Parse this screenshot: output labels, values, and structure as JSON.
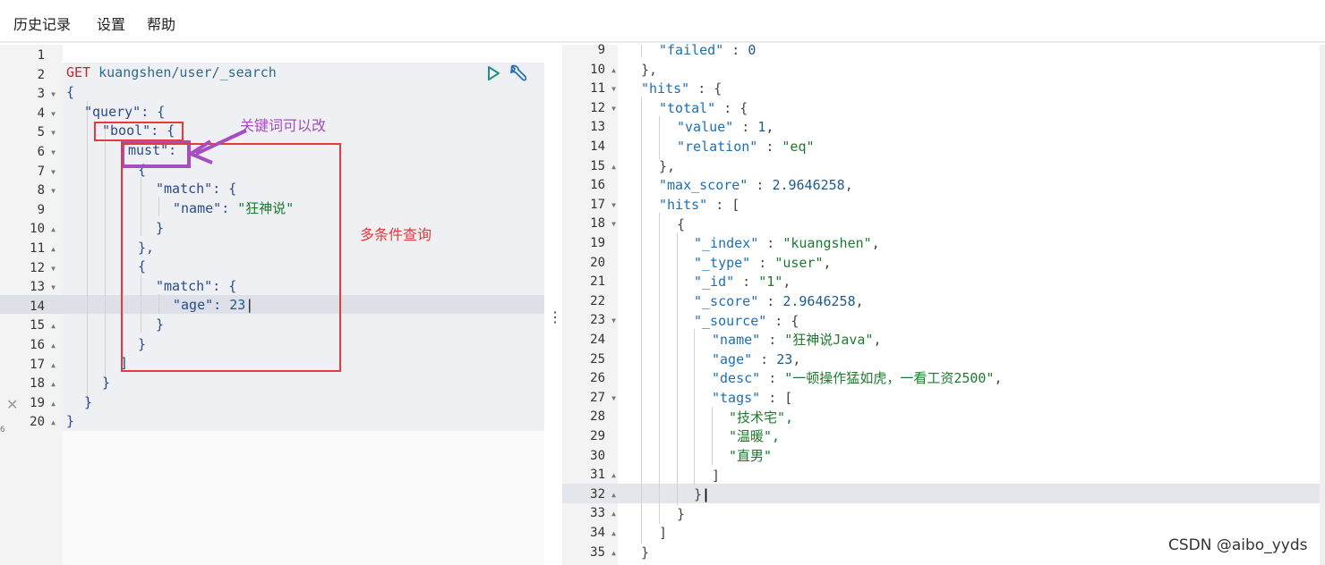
{
  "menu": {
    "history": "历史记录",
    "settings": "设置",
    "help": "帮助"
  },
  "request": {
    "method": "GET",
    "url": "kuangshen/user/_search"
  },
  "annotations": {
    "keyword_changeable": "关键词可以改",
    "multi_condition": "多条件查询"
  },
  "watermark": "CSDN @aibo_yyds",
  "splitter": "⋮",
  "edge_mark": "6",
  "left_lines": [
    {
      "n": "1",
      "fold": ""
    },
    {
      "n": "2",
      "fold": ""
    },
    {
      "n": "3",
      "fold": "▼"
    },
    {
      "n": "4",
      "fold": "▼"
    },
    {
      "n": "5",
      "fold": "▼"
    },
    {
      "n": "6",
      "fold": "▼"
    },
    {
      "n": "7",
      "fold": "▼"
    },
    {
      "n": "8",
      "fold": "▼"
    },
    {
      "n": "9",
      "fold": ""
    },
    {
      "n": "10",
      "fold": "▲"
    },
    {
      "n": "11",
      "fold": "▲"
    },
    {
      "n": "12",
      "fold": "▼"
    },
    {
      "n": "13",
      "fold": "▼"
    },
    {
      "n": "14",
      "fold": ""
    },
    {
      "n": "15",
      "fold": "▲"
    },
    {
      "n": "16",
      "fold": "▲"
    },
    {
      "n": "17",
      "fold": "▲"
    },
    {
      "n": "18",
      "fold": "▲"
    },
    {
      "n": "19",
      "fold": "▲"
    },
    {
      "n": "20",
      "fold": "▲"
    }
  ],
  "left_code": {
    "brace_open": "{",
    "query_key": "\"query\"",
    "query_rest": ": {",
    "bool_key": "\"bool\"",
    "bool_rest": ": {",
    "must_key": "must\"",
    "must_rest": ": [",
    "obj_open": "{",
    "match_key": "\"match\"",
    "match_rest": ": {",
    "name_key": "\"name\"",
    "colon": ": ",
    "name_val": "\"狂神说\"",
    "inner_close": "}",
    "obj_close_comma": "},",
    "age_key": "\"age\"",
    "age_val": "23",
    "bracket_close": "]",
    "close": "}"
  },
  "right_lines": [
    {
      "n": "9",
      "fold": ""
    },
    {
      "n": "10",
      "fold": "▲"
    },
    {
      "n": "11",
      "fold": "▼"
    },
    {
      "n": "12",
      "fold": "▼"
    },
    {
      "n": "13",
      "fold": ""
    },
    {
      "n": "14",
      "fold": ""
    },
    {
      "n": "15",
      "fold": "▲"
    },
    {
      "n": "16",
      "fold": ""
    },
    {
      "n": "17",
      "fold": "▼"
    },
    {
      "n": "18",
      "fold": "▼"
    },
    {
      "n": "19",
      "fold": ""
    },
    {
      "n": "20",
      "fold": ""
    },
    {
      "n": "21",
      "fold": ""
    },
    {
      "n": "22",
      "fold": ""
    },
    {
      "n": "23",
      "fold": "▼"
    },
    {
      "n": "24",
      "fold": ""
    },
    {
      "n": "25",
      "fold": ""
    },
    {
      "n": "26",
      "fold": ""
    },
    {
      "n": "27",
      "fold": "▼"
    },
    {
      "n": "28",
      "fold": ""
    },
    {
      "n": "29",
      "fold": ""
    },
    {
      "n": "30",
      "fold": ""
    },
    {
      "n": "31",
      "fold": "▲"
    },
    {
      "n": "32",
      "fold": "▲"
    },
    {
      "n": "33",
      "fold": "▲"
    },
    {
      "n": "34",
      "fold": "▲"
    },
    {
      "n": "35",
      "fold": "▲"
    }
  ],
  "right_code": {
    "failed_key": "\"failed\"",
    "failed_rest": " : ",
    "failed_val": "0",
    "close_comma": "},",
    "hits_key": "\"hits\"",
    "obj_open_rest": " : {",
    "total_key": "\"total\"",
    "value_key": "\"value\"",
    "sep": " : ",
    "value_val": "1",
    "comma": ",",
    "relation_key": "\"relation\"",
    "relation_val": "\"eq\"",
    "max_score_key": "\"max_score\"",
    "max_score_val": "2.9646258",
    "hits_inner_key": "\"hits\"",
    "arr_open_rest": " : [",
    "obj_open": "{",
    "index_key": "\"_index\"",
    "index_val": "\"kuangshen\"",
    "type_key": "\"_type\"",
    "type_val": "\"user\"",
    "id_key": "\"_id\"",
    "id_val": "\"1\"",
    "score_key": "\"_score\"",
    "score_val": "2.9646258",
    "source_key": "\"_source\"",
    "name_key": "\"name\"",
    "name_val": "\"狂神说Java\"",
    "age_key": "\"age\"",
    "age_val": "23",
    "desc_key": "\"desc\"",
    "desc_val": "\"一顿操作猛如虎，一看工资2500\"",
    "tags_key": "\"tags\"",
    "tag1": "\"技术宅\",",
    "tag2": "\"温暖\",",
    "tag3": "\"直男\"",
    "bracket_close": "]",
    "brace_close": "}"
  }
}
